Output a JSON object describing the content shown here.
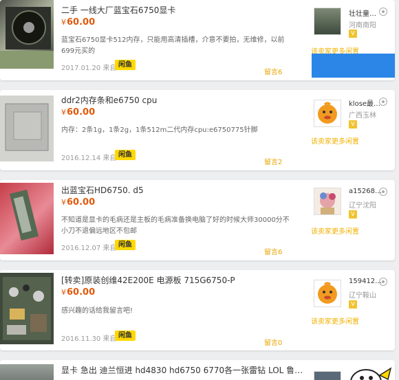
{
  "listings": [
    {
      "title": "二手 一线大厂蓝宝石6750显卡",
      "currency": "¥",
      "price": "60.00",
      "description": "蓝宝石6750显卡512内存，只能用高清插槽，介意不要拍，无维修，以前699元买的",
      "date": "2017.01.20",
      "from": "来自",
      "badge": "闲鱼",
      "comments": "留言6",
      "seller": "壮壮童…",
      "location": "河南南阳",
      "more_link": "该卖家更多闲置"
    },
    {
      "title": "ddr2内存条和e6750 cpu",
      "currency": "¥",
      "price": "60.00",
      "description": "内存：2条1g，1条2g，1条512m二代内存cpu:e6750775针脚",
      "date": "2016.12.14",
      "from": "来自",
      "badge": "闲鱼",
      "comments": "留言2",
      "seller": "klose最…",
      "location": "广西玉林",
      "more_link": "该卖家更多闲置"
    },
    {
      "title": "出蓝宝石HD6750. d5",
      "currency": "¥",
      "price": "60.00",
      "description": "不知道是显卡的毛病还是主板的毛病准备换电脑了好的时候大师30000分不小刀不退偏远地区不包邮",
      "date": "2016.12.07",
      "from": "来自",
      "badge": "闲鱼",
      "comments": "留言6",
      "seller": "a15268…",
      "location": "辽宁沈阳",
      "more_link": "该卖家更多闲置"
    },
    {
      "title": "[转卖]原装创维42E200E 电源板 715G6750-P",
      "currency": "¥",
      "price": "60.00",
      "description": "感兴趣的话给我留言吧!",
      "date": "2016.11.30",
      "from": "来自",
      "badge": "闲鱼",
      "comments": "留言0",
      "seller": "159412…",
      "location": "辽宁鞍山",
      "more_link": "该卖家更多闲置"
    },
    {
      "title": "显卡 急出 迪兰恒进 hd4830 hd6750 6770各一张雷钻 LOL 鲁…"
    }
  ],
  "level_badge": "V",
  "colors": {
    "price": "#e05a0c",
    "badge": "#ffd800",
    "link": "#f0b000",
    "overlay": "#2b86e8"
  }
}
